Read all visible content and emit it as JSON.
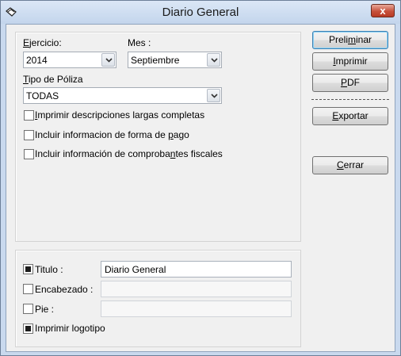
{
  "window": {
    "title": "Diario General",
    "close_symbol": "x",
    "icon": "app-icon"
  },
  "form": {
    "ejercicio": {
      "label_u": "E",
      "label_rest": "jercicio:",
      "value": "2014"
    },
    "mes": {
      "label": "Mes :",
      "value": "Septiembre"
    },
    "tipo_poliza": {
      "label_u": "T",
      "label_rest": "ipo de Póliza",
      "value": "TODAS"
    },
    "options": [
      {
        "pre": "",
        "u": "I",
        "post": "mprimir descripciones largas completas",
        "checked": false
      },
      {
        "pre": "Incluir informacion de forma de ",
        "u": "p",
        "post": "ago",
        "checked": false
      },
      {
        "pre": "Incluir información de comproba",
        "u": "n",
        "post": "tes fiscales",
        "checked": false
      }
    ]
  },
  "report": {
    "titulo": {
      "label": "Titulo :",
      "checked": true,
      "value": "Diario General"
    },
    "encabezado": {
      "label": "Encabezado :",
      "checked": false,
      "value": ""
    },
    "pie": {
      "label": "Pie :",
      "checked": false,
      "value": ""
    },
    "logotipo": {
      "label": "Imprimir logotipo",
      "checked": true
    }
  },
  "buttons": {
    "preliminar": {
      "pre": "Preli",
      "u": "m",
      "post": "inar"
    },
    "imprimir": {
      "pre": "",
      "u": "I",
      "post": "mprimir"
    },
    "pdf": {
      "pre": "",
      "u": "P",
      "post": "DF"
    },
    "exportar": {
      "pre": "",
      "u": "E",
      "post": "xportar"
    },
    "cerrar": {
      "pre": "",
      "u": "C",
      "post": "errar"
    }
  }
}
